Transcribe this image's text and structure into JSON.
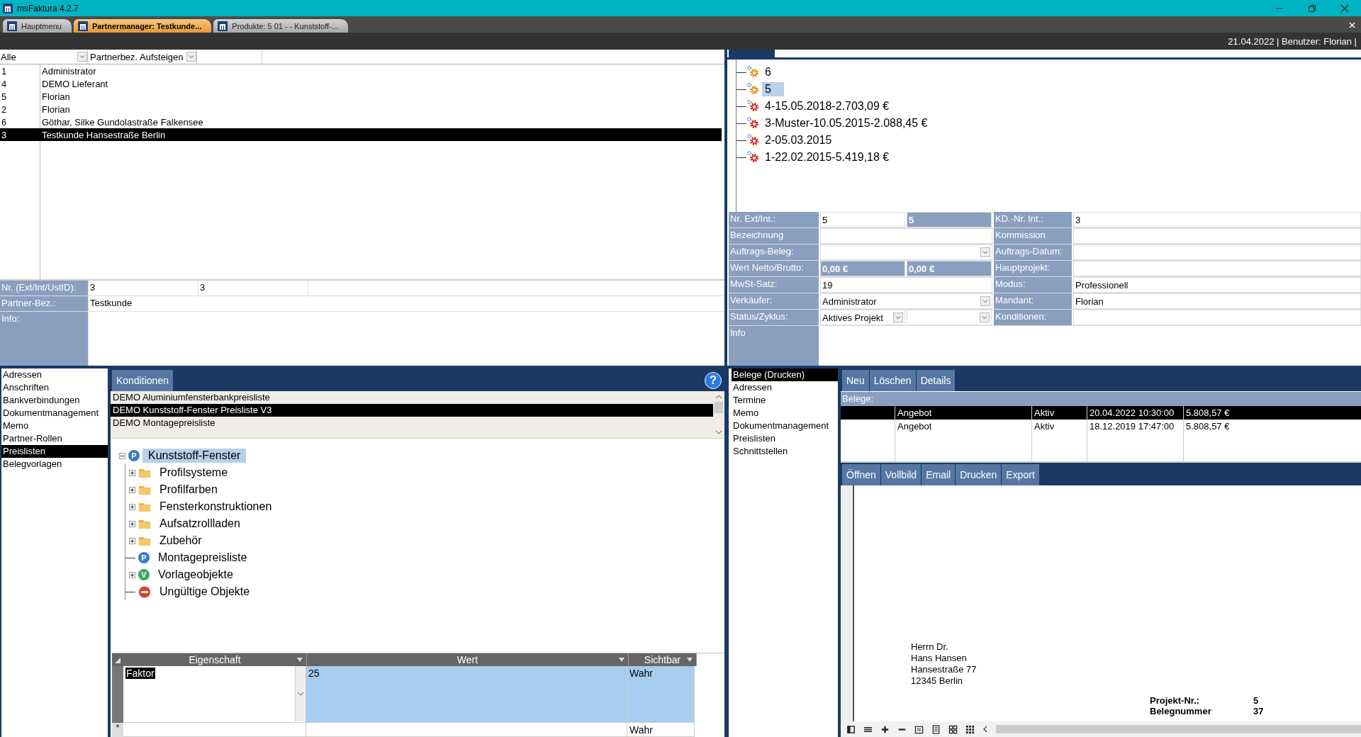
{
  "window": {
    "title": "msFaktura 4.2.7"
  },
  "tabs": [
    {
      "label": "Hauptmenu",
      "selected": false
    },
    {
      "label": "Partnermanager: Testkunde...",
      "selected": true
    },
    {
      "label": "Produkte: 5 01 - - Kunststoff-...",
      "selected": false
    }
  ],
  "status": "21.04.2022 | Benutzer: Florian |",
  "partner_filters": [
    "Alle",
    "Partnerbez. Aufsteigen"
  ],
  "partners": [
    {
      "id": "1",
      "name": "Administrator",
      "selected": false
    },
    {
      "id": "4",
      "name": "DEMO Lieferant",
      "selected": false
    },
    {
      "id": "5",
      "name": "Florian",
      "selected": false
    },
    {
      "id": "2",
      "name": "Florian",
      "selected": false
    },
    {
      "id": "6",
      "name": "Göthar, Silke Gundolastraße Falkensee",
      "selected": false
    },
    {
      "id": "3",
      "name": "Testkunde Hansestraße Berlin",
      "selected": true
    }
  ],
  "partner_form": [
    {
      "label": "Nr. (Ext/Int/UstID):",
      "values": [
        "3",
        "3"
      ],
      "kind": "line"
    },
    {
      "label": "Partner-Bez.:",
      "values": [
        "Testkunde"
      ],
      "kind": "line"
    },
    {
      "label": "Info:",
      "kind": "memo"
    }
  ],
  "projects": [
    {
      "label": "6",
      "color": "#e8900c",
      "selected": false
    },
    {
      "label": "5",
      "color": "#e8900c",
      "selected": true
    },
    {
      "label": "4-15.05.2018-2.703,09 €",
      "color": "#e02020",
      "selected": false
    },
    {
      "label": "3-Muster-10.05.2015-2.088,45 €",
      "color": "#e02020",
      "selected": false
    },
    {
      "label": "2-05.03.2015",
      "color": "#e02020",
      "selected": false
    },
    {
      "label": "1-22.02.2015-5.419,18 €",
      "color": "#e02020",
      "selected": false
    }
  ],
  "project_form": [
    {
      "label": "Nr. Ext/Int.:",
      "fields": [
        {
          "kind": "text",
          "value": "5"
        },
        {
          "kind": "shaded",
          "value": "5"
        }
      ],
      "label2": "KD.-Nr. Int.:",
      "value2": "3"
    },
    {
      "label": "Bezeichnung",
      "fields": [
        {
          "kind": "text"
        }
      ],
      "label2": "Kommission"
    },
    {
      "label": "Auftrags-Beleg:",
      "fields": [
        {
          "kind": "dropdown"
        }
      ],
      "label2": "Auftrags-Datum:"
    },
    {
      "label": "Wert Netto/Brutto:",
      "fields": [
        {
          "kind": "shaded",
          "value": "0,00 €"
        },
        {
          "kind": "shaded",
          "value": "0,00 €"
        }
      ],
      "label2": "Hauptprojekt:"
    },
    {
      "label": "MwSt-Satz:",
      "fields": [
        {
          "kind": "text",
          "value": "19"
        }
      ],
      "label2": "Modus:",
      "value2": "Professionell"
    },
    {
      "label": "Verkäufer:",
      "fields": [
        {
          "kind": "dropdown",
          "value": "Administrator"
        }
      ],
      "label2": "Mandant:",
      "value2": "Florian"
    },
    {
      "label": "Status/Zyklus:",
      "fields": [
        {
          "kind": "dropdown",
          "value": "Aktives Projekt"
        },
        {
          "kind": "dropdown"
        }
      ],
      "label2": "Konditionen:"
    }
  ],
  "project_info_label": "Info",
  "partner_sections": [
    {
      "label": "Adressen",
      "selected": false
    },
    {
      "label": "Anschriften",
      "selected": false
    },
    {
      "label": "Bankverbindungen",
      "selected": false
    },
    {
      "label": "Dokumentmanagement",
      "selected": false
    },
    {
      "label": "Memo",
      "selected": false
    },
    {
      "label": "Partner-Rollen",
      "selected": false
    },
    {
      "label": "Preislisten",
      "selected": true
    },
    {
      "label": "Belegvorlagen",
      "selected": false
    }
  ],
  "conditions_tab": "Konditionen",
  "help": "?",
  "price_lists": [
    {
      "label": "DEMO Aluminiumfensterbankpreisliste",
      "selected": false
    },
    {
      "label": "DEMO Kunststoff-Fenster Preisliste V3",
      "selected": true
    },
    {
      "label": "DEMO Montagepreisliste",
      "selected": false
    }
  ],
  "price_tree": {
    "label": "Kunststoff-Fenster",
    "kind": "pricelist",
    "badge": "P",
    "expanded": true,
    "selected": true,
    "children": [
      {
        "label": "Profilsysteme",
        "kind": "folder",
        "expanded": false
      },
      {
        "label": "Profilfarben",
        "kind": "folder",
        "expanded": false
      },
      {
        "label": "Fensterkonstruktionen",
        "kind": "folder",
        "expanded": false
      },
      {
        "label": "Aufsatzrollladen",
        "kind": "folder",
        "expanded": false
      },
      {
        "label": "Zubehör",
        "kind": "folder",
        "expanded": false
      },
      {
        "label": "Montagepreisliste",
        "kind": "pricelist",
        "badge": "P"
      },
      {
        "label": "Vorlageobjekte",
        "kind": "template",
        "badge": "V",
        "expanded": false
      },
      {
        "label": "Ungültige Objekte",
        "kind": "invalid"
      }
    ]
  },
  "property_grid": {
    "columns": [
      "Eigenschaft",
      "Wert",
      "Sichtbar"
    ],
    "rows": [
      {
        "cells": [
          "Faktor",
          "25",
          "Wahr"
        ],
        "selected": true
      }
    ],
    "new_row": {
      "marker": "*",
      "sichtbar": "Wahr"
    }
  },
  "project_sections": [
    {
      "label": "Belege (Drucken)",
      "selected": true
    },
    {
      "label": "Adressen",
      "selected": false
    },
    {
      "label": "Termine",
      "selected": false
    },
    {
      "label": "Memo",
      "selected": false
    },
    {
      "label": "Dokumentmanagement",
      "selected": false
    },
    {
      "label": "Preislisten",
      "selected": false
    },
    {
      "label": "Schnittstellen",
      "selected": false
    }
  ],
  "document_actions": [
    "Neu",
    "Löschen",
    "Details"
  ],
  "documents_label": "Belege:",
  "documents": [
    {
      "cells": [
        "Angebot",
        "Aktiv",
        "20.04.2022 10:30:00",
        "5.808,57 €"
      ],
      "selected": true
    },
    {
      "cells": [
        "Angebot",
        "Aktiv",
        "18.12.2019 17:47:00",
        "5.808,57 €"
      ],
      "selected": false
    }
  ],
  "preview_actions": [
    "Öffnen",
    "Vollbild",
    "Email",
    "Drucken",
    "Export"
  ],
  "preview": {
    "address": [
      "Herrn Dr.",
      "Hans Hansen",
      "Hansestraße 77",
      "12345 Berlin"
    ],
    "fields": [
      {
        "label": "Projekt-Nr.:",
        "value": "5"
      },
      {
        "label": "Belegnummer",
        "value": "37"
      }
    ]
  }
}
